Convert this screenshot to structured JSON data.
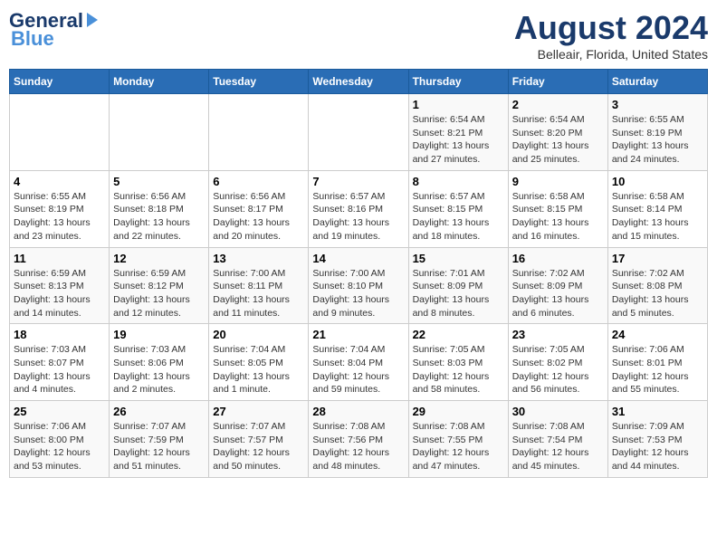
{
  "header": {
    "logo_general": "General",
    "logo_blue": "Blue",
    "month_year": "August 2024",
    "location": "Belleair, Florida, United States"
  },
  "columns": [
    "Sunday",
    "Monday",
    "Tuesday",
    "Wednesday",
    "Thursday",
    "Friday",
    "Saturday"
  ],
  "weeks": [
    [
      {
        "day": "",
        "detail": ""
      },
      {
        "day": "",
        "detail": ""
      },
      {
        "day": "",
        "detail": ""
      },
      {
        "day": "",
        "detail": ""
      },
      {
        "day": "1",
        "detail": "Sunrise: 6:54 AM\nSunset: 8:21 PM\nDaylight: 13 hours\nand 27 minutes."
      },
      {
        "day": "2",
        "detail": "Sunrise: 6:54 AM\nSunset: 8:20 PM\nDaylight: 13 hours\nand 25 minutes."
      },
      {
        "day": "3",
        "detail": "Sunrise: 6:55 AM\nSunset: 8:19 PM\nDaylight: 13 hours\nand 24 minutes."
      }
    ],
    [
      {
        "day": "4",
        "detail": "Sunrise: 6:55 AM\nSunset: 8:19 PM\nDaylight: 13 hours\nand 23 minutes."
      },
      {
        "day": "5",
        "detail": "Sunrise: 6:56 AM\nSunset: 8:18 PM\nDaylight: 13 hours\nand 22 minutes."
      },
      {
        "day": "6",
        "detail": "Sunrise: 6:56 AM\nSunset: 8:17 PM\nDaylight: 13 hours\nand 20 minutes."
      },
      {
        "day": "7",
        "detail": "Sunrise: 6:57 AM\nSunset: 8:16 PM\nDaylight: 13 hours\nand 19 minutes."
      },
      {
        "day": "8",
        "detail": "Sunrise: 6:57 AM\nSunset: 8:15 PM\nDaylight: 13 hours\nand 18 minutes."
      },
      {
        "day": "9",
        "detail": "Sunrise: 6:58 AM\nSunset: 8:15 PM\nDaylight: 13 hours\nand 16 minutes."
      },
      {
        "day": "10",
        "detail": "Sunrise: 6:58 AM\nSunset: 8:14 PM\nDaylight: 13 hours\nand 15 minutes."
      }
    ],
    [
      {
        "day": "11",
        "detail": "Sunrise: 6:59 AM\nSunset: 8:13 PM\nDaylight: 13 hours\nand 14 minutes."
      },
      {
        "day": "12",
        "detail": "Sunrise: 6:59 AM\nSunset: 8:12 PM\nDaylight: 13 hours\nand 12 minutes."
      },
      {
        "day": "13",
        "detail": "Sunrise: 7:00 AM\nSunset: 8:11 PM\nDaylight: 13 hours\nand 11 minutes."
      },
      {
        "day": "14",
        "detail": "Sunrise: 7:00 AM\nSunset: 8:10 PM\nDaylight: 13 hours\nand 9 minutes."
      },
      {
        "day": "15",
        "detail": "Sunrise: 7:01 AM\nSunset: 8:09 PM\nDaylight: 13 hours\nand 8 minutes."
      },
      {
        "day": "16",
        "detail": "Sunrise: 7:02 AM\nSunset: 8:09 PM\nDaylight: 13 hours\nand 6 minutes."
      },
      {
        "day": "17",
        "detail": "Sunrise: 7:02 AM\nSunset: 8:08 PM\nDaylight: 13 hours\nand 5 minutes."
      }
    ],
    [
      {
        "day": "18",
        "detail": "Sunrise: 7:03 AM\nSunset: 8:07 PM\nDaylight: 13 hours\nand 4 minutes."
      },
      {
        "day": "19",
        "detail": "Sunrise: 7:03 AM\nSunset: 8:06 PM\nDaylight: 13 hours\nand 2 minutes."
      },
      {
        "day": "20",
        "detail": "Sunrise: 7:04 AM\nSunset: 8:05 PM\nDaylight: 13 hours\nand 1 minute."
      },
      {
        "day": "21",
        "detail": "Sunrise: 7:04 AM\nSunset: 8:04 PM\nDaylight: 12 hours\nand 59 minutes."
      },
      {
        "day": "22",
        "detail": "Sunrise: 7:05 AM\nSunset: 8:03 PM\nDaylight: 12 hours\nand 58 minutes."
      },
      {
        "day": "23",
        "detail": "Sunrise: 7:05 AM\nSunset: 8:02 PM\nDaylight: 12 hours\nand 56 minutes."
      },
      {
        "day": "24",
        "detail": "Sunrise: 7:06 AM\nSunset: 8:01 PM\nDaylight: 12 hours\nand 55 minutes."
      }
    ],
    [
      {
        "day": "25",
        "detail": "Sunrise: 7:06 AM\nSunset: 8:00 PM\nDaylight: 12 hours\nand 53 minutes."
      },
      {
        "day": "26",
        "detail": "Sunrise: 7:07 AM\nSunset: 7:59 PM\nDaylight: 12 hours\nand 51 minutes."
      },
      {
        "day": "27",
        "detail": "Sunrise: 7:07 AM\nSunset: 7:57 PM\nDaylight: 12 hours\nand 50 minutes."
      },
      {
        "day": "28",
        "detail": "Sunrise: 7:08 AM\nSunset: 7:56 PM\nDaylight: 12 hours\nand 48 minutes."
      },
      {
        "day": "29",
        "detail": "Sunrise: 7:08 AM\nSunset: 7:55 PM\nDaylight: 12 hours\nand 47 minutes."
      },
      {
        "day": "30",
        "detail": "Sunrise: 7:08 AM\nSunset: 7:54 PM\nDaylight: 12 hours\nand 45 minutes."
      },
      {
        "day": "31",
        "detail": "Sunrise: 7:09 AM\nSunset: 7:53 PM\nDaylight: 12 hours\nand 44 minutes."
      }
    ]
  ]
}
